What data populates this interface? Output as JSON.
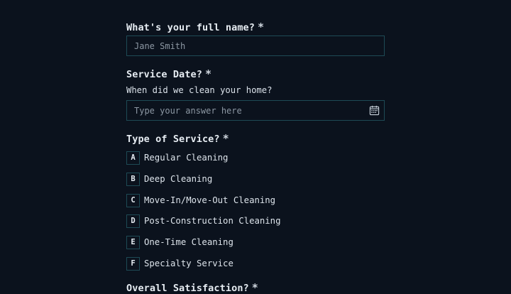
{
  "questions": {
    "name": {
      "title": "What's your full name?",
      "required_mark": "*",
      "placeholder": "Jane Smith"
    },
    "service_date": {
      "title": "Service Date?",
      "required_mark": "*",
      "subtitle": "When did we clean your home?",
      "placeholder": "Type your answer here",
      "icon": "calendar-icon"
    },
    "service_type": {
      "title": "Type of Service?",
      "required_mark": "*",
      "options": [
        {
          "key": "A",
          "label": "Regular Cleaning"
        },
        {
          "key": "B",
          "label": "Deep Cleaning"
        },
        {
          "key": "C",
          "label": "Move-In/Move-Out Cleaning"
        },
        {
          "key": "D",
          "label": "Post-Construction Cleaning"
        },
        {
          "key": "E",
          "label": "One-Time Cleaning"
        },
        {
          "key": "F",
          "label": "Specialty Service"
        }
      ]
    },
    "satisfaction": {
      "title": "Overall Satisfaction?",
      "required_mark": "*"
    }
  },
  "colors": {
    "background": "#0b121d",
    "border": "#1e4a55",
    "text": "#e6ecf2"
  }
}
